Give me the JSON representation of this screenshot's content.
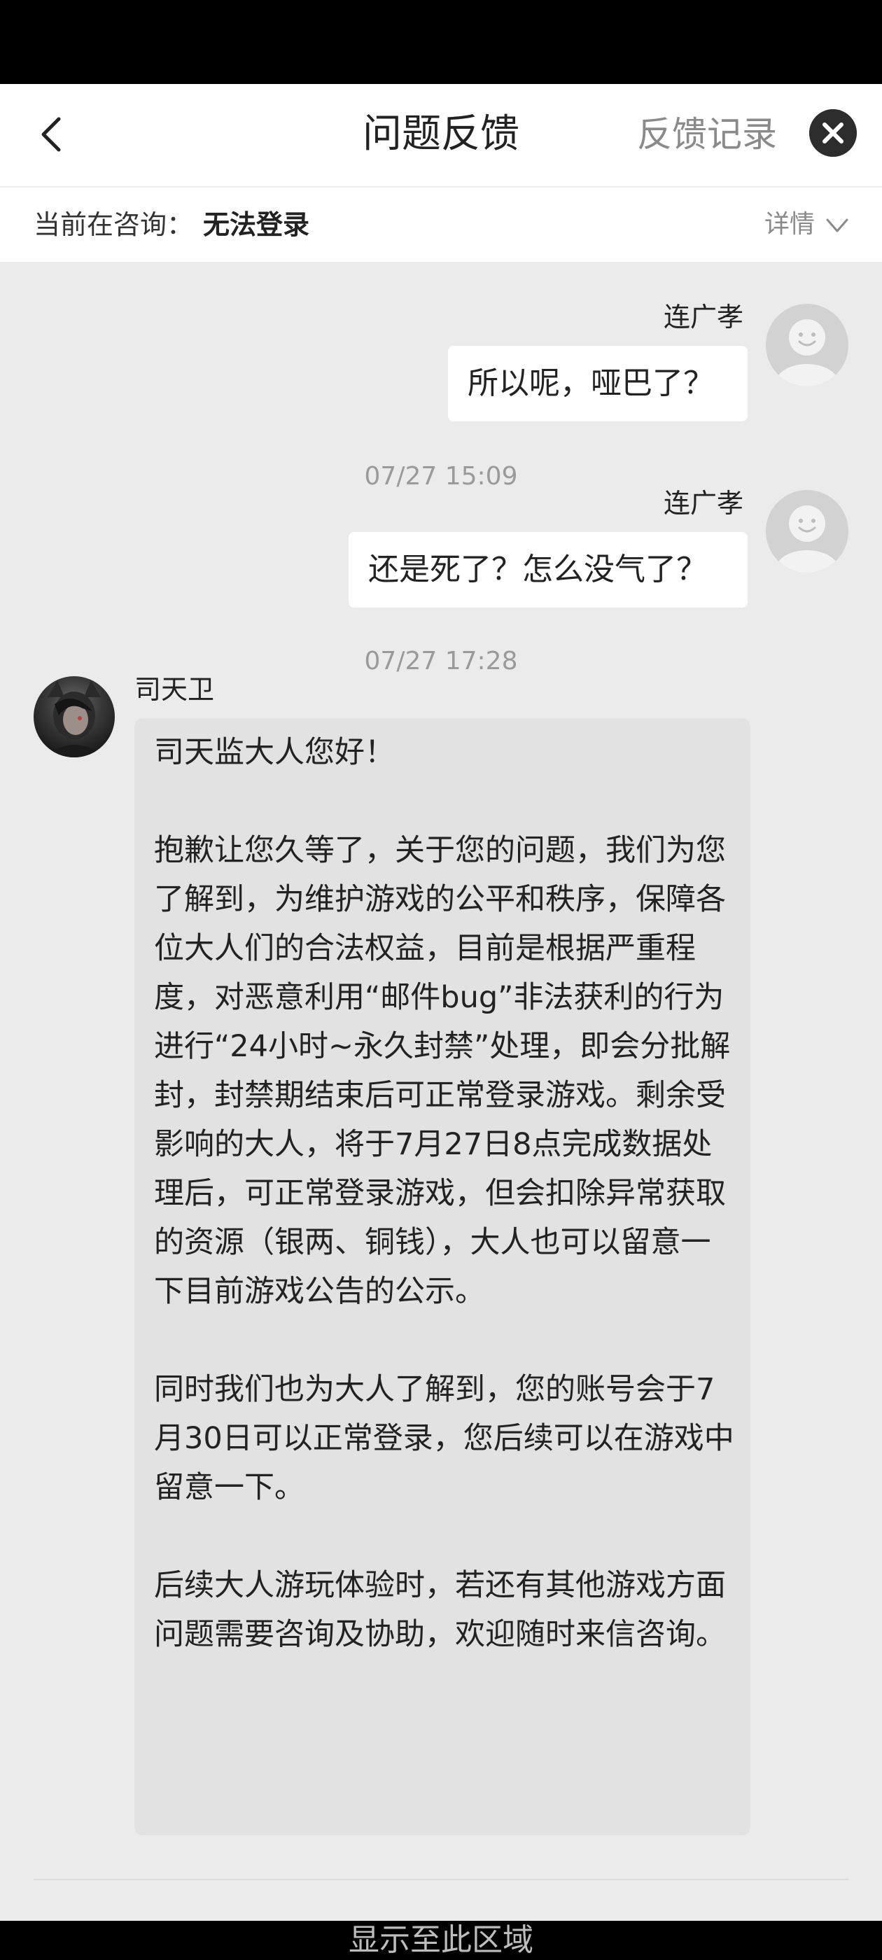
{
  "header": {
    "title": "问题反馈",
    "records_link": "反馈记录"
  },
  "subheader": {
    "consult_prefix": "当前在咨询：",
    "consult_topic": "无法登录",
    "details_label": "详情"
  },
  "messages": [
    {
      "sender": "连广孝",
      "text": "所以呢，哑巴了？"
    },
    {
      "timestamp": "07/27 15:09",
      "sender": "连广孝",
      "text": "还是死了？怎么没气了？"
    },
    {
      "timestamp": "07/27 17:28",
      "sender": "司天卫",
      "paragraphs": [
        "司天监大人您好！",
        "抱歉让您久等了，关于您的问题，我们为您了解到，为维护游戏的公平和秩序，保障各位大人们的合法权益，目前是根据严重程度，对恶意利用“邮件bug”非法获利的行为进行“24小时~永久封禁”处理，即会分批解封，封禁期结束后可正常登录游戏。剩余受影响的大人，将于7月27日8点完成数据处理后，可正常登录游戏，但会扣除异常获取的资源（银两、铜钱），大人也可以留意一下目前游戏公告的公示。",
        "同时我们也为大人了解到，您的账号会于7月30日可以正常登录，您后续可以在游戏中留意一下。",
        "后续大人游玩体验时，若还有其他游戏方面问题需要咨询及协助，欢迎随时来信咨询。"
      ]
    }
  ],
  "bottom_bar": {
    "label": "显示至此区域"
  },
  "colors": {
    "background": "#ebebeb",
    "agent_bubble": "#e2e2e2",
    "user_bubble": "#ffffff"
  }
}
